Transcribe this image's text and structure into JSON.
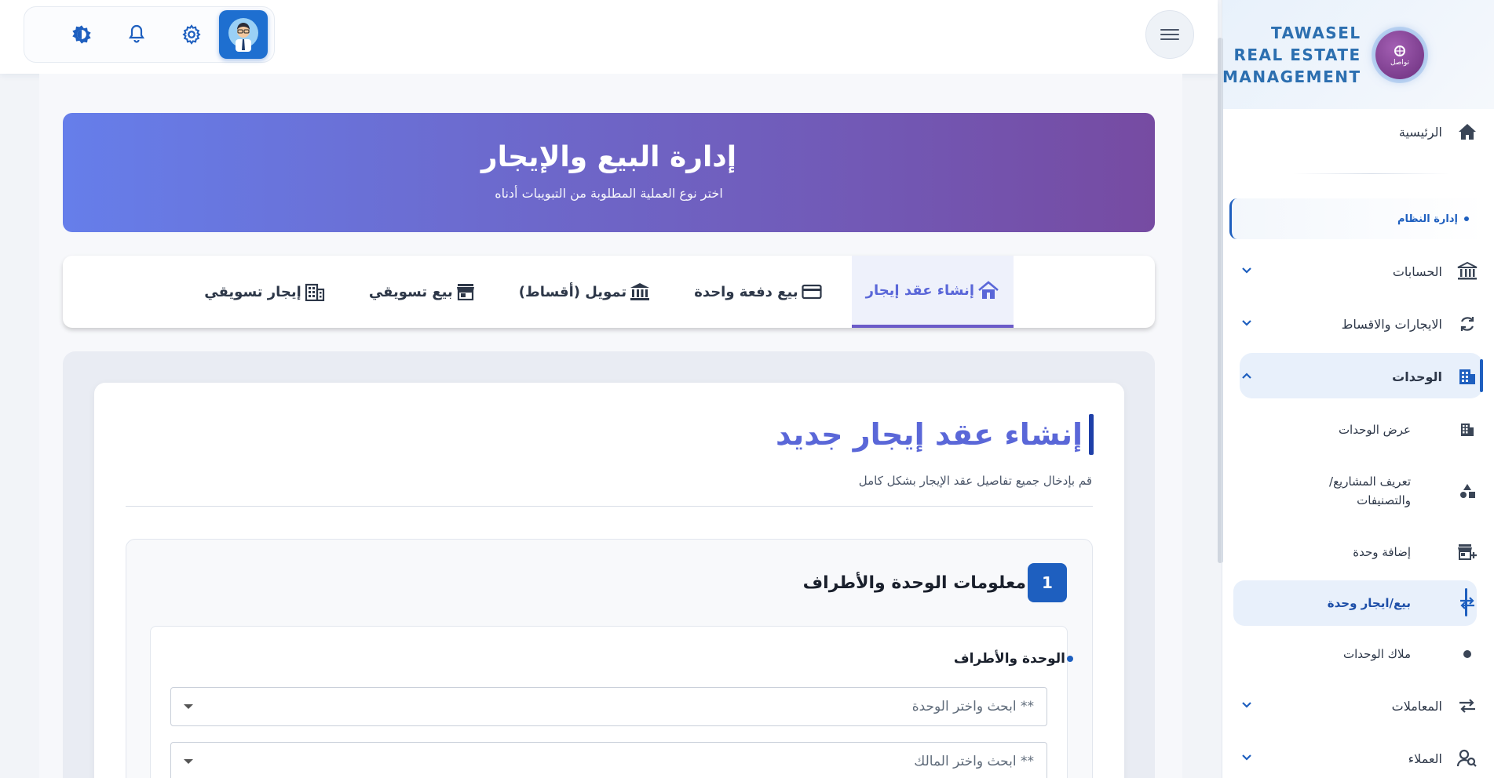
{
  "brand": {
    "name_lines": [
      "TAWASEL",
      "REAL ESTATE",
      "MANAGEMENT"
    ],
    "logo_text": "تواصل"
  },
  "sidebar": {
    "home": "الرئيسية",
    "section_label": "إدارة النظام",
    "items": [
      {
        "label": "الحسابات",
        "icon": "bank-icon",
        "expanded": false
      },
      {
        "label": "الايجارات والاقساط",
        "icon": "refresh-icon",
        "expanded": false
      },
      {
        "label": "الوحدات",
        "icon": "building-icon",
        "expanded": true
      }
    ],
    "units_children": [
      {
        "label": "عرض الوحدات",
        "icon": "building-icon"
      },
      {
        "label": "تعريف المشاريع/ والتصنيفات",
        "icon": "shapes-icon"
      },
      {
        "label": "إضافة وحدة",
        "icon": "store-add-icon"
      },
      {
        "label": "بيع/ايجار وحدة",
        "icon": "swap-icon",
        "active": true
      },
      {
        "label": "ملاك الوحدات",
        "icon": "dot-icon"
      }
    ],
    "more": [
      {
        "label": "المعاملات",
        "icon": "swap-icon"
      },
      {
        "label": "العملاء",
        "icon": "user-search-icon"
      }
    ]
  },
  "hero": {
    "title": "إدارة البيع والإيجار",
    "subtitle": "اختر نوع العملية المطلوبة من التبويبات أدناه"
  },
  "tabs": [
    {
      "label": "إنشاء عقد إيجار",
      "icon": "house-icon",
      "active": true
    },
    {
      "label": "بيع دفعة واحدة",
      "icon": "card-icon"
    },
    {
      "label": "تمويل (أقساط)",
      "icon": "bank-icon"
    },
    {
      "label": "بيع تسويقي",
      "icon": "store-icon"
    },
    {
      "label": "إيجار تسويقي",
      "icon": "building-icon"
    }
  ],
  "form": {
    "title": "إنشاء عقد إيجار جديد",
    "subtitle": "قم بإدخال جميع تفاصيل عقد الإيجار بشكل كامل",
    "section": {
      "step": "1",
      "title": "معلومات الوحدة والأطراف",
      "group_label": "الوحدة والأطراف",
      "unit_placeholder": "ابحث واختر الوحدة **",
      "owner_placeholder": "ابحث واختر المالك **"
    }
  },
  "colors": {
    "primary": "#1e5fbf",
    "hero_start": "#667eea",
    "hero_end": "#764ba2",
    "tab_active": "#5a67d8"
  }
}
